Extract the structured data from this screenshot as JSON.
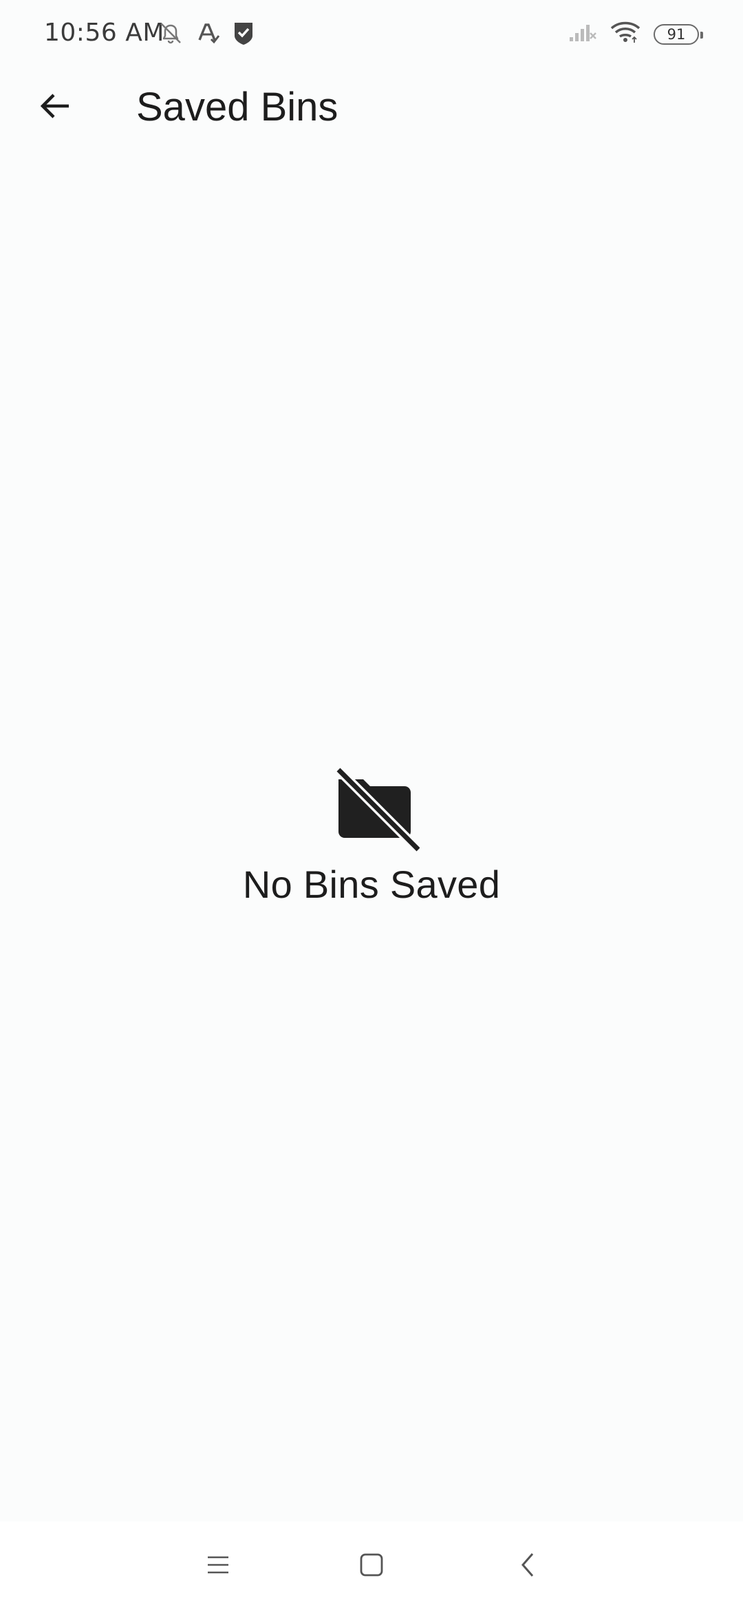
{
  "status_bar": {
    "time": "10:56 AM",
    "left_icons": [
      "alarm-off-icon",
      "a-check-icon",
      "shield-check-icon"
    ],
    "right_icons": [
      "signal-off-icon",
      "wifi-icon"
    ],
    "battery": "91"
  },
  "app_bar": {
    "back_icon": "arrow-left-icon",
    "title": "Saved Bins"
  },
  "empty_state": {
    "icon": "folder-off-icon",
    "message": "No Bins Saved"
  },
  "nav_bar": {
    "items": [
      "menu-icon",
      "home-square-icon",
      "back-chevron-icon"
    ]
  },
  "colors": {
    "background": "#fbfcfc",
    "text": "#1d1d1d",
    "nav_background": "#ffffff"
  }
}
